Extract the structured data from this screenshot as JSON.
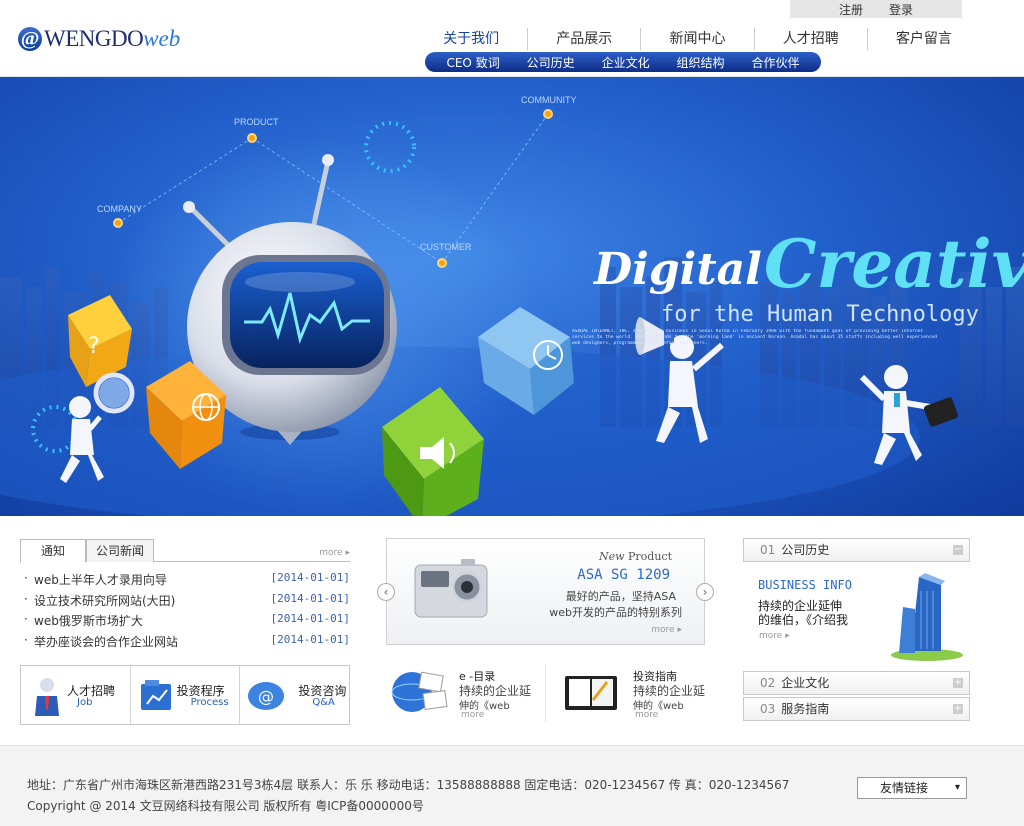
{
  "topbar": {
    "register": "注册",
    "login": "登录"
  },
  "logo": {
    "at": "@",
    "name_a": "WENGDO",
    "name_b": "web"
  },
  "nav": {
    "items": [
      "关于我们",
      "产品展示",
      "新闻中心",
      "人才招聘",
      "客户留言"
    ],
    "active": 0,
    "sub_items": [
      "CEO 致词",
      "公司历史",
      "企业文化",
      "组织结构",
      "合作伙伴"
    ]
  },
  "banner": {
    "word1": "Digital",
    "word2": "Creative",
    "tagline": "for the Human Technology",
    "blurb": "ASADAL INTERNET, INC. started its business in Seoul Korea in February 1998 with the fundament goal of providing better internet services to the world. ASADAL stands for the 'morning land' in ancient Korean. Asadal has about 35 staffs including well experienced web designers, programmers, and server engineers.",
    "labels": {
      "product": "PRODUCT",
      "community": "COMMUNITY",
      "company": "COMPANY",
      "customer": "CUSTOMER"
    }
  },
  "news": {
    "tabs": [
      "通知",
      "公司新闻"
    ],
    "more": "more",
    "bullet": "·",
    "items": [
      {
        "title": "web上半年人才录用向导",
        "date": "[2014-01-01]"
      },
      {
        "title": "设立技术研究所网站(大田)",
        "date": "[2014-01-01]"
      },
      {
        "title": "web俄罗斯市场扩大",
        "date": "[2014-01-01]"
      },
      {
        "title": "举办座谈会的合作企业网站",
        "date": "[2014-01-01]"
      }
    ]
  },
  "quick": [
    {
      "title": "人才招聘",
      "sub": "Job"
    },
    {
      "title": "投资程序",
      "sub": "Process"
    },
    {
      "title": "投资咨询",
      "sub": "Q&A"
    }
  ],
  "product": {
    "new_label_a": "New",
    "new_label_b": "Product",
    "model": "ASA SG 1209",
    "desc1": "最好的产品，坚持ASA",
    "desc2": "web开发的产品的特别系列",
    "more": "more"
  },
  "features": [
    {
      "title": "e -目录",
      "line1": "持续的企业延",
      "line2": "伸的《web",
      "more": "more"
    },
    {
      "title": "投资指南",
      "line1": "持续的企业延",
      "line2": "伸的《web",
      "more": "more"
    }
  ],
  "right": {
    "box1": {
      "num": "01",
      "title": "公司历史",
      "pm": "−"
    },
    "business_info": "BUSINESS INFO",
    "info1": "持续的企业延伸",
    "info2": "的维伯，《介绍我",
    "more": "more",
    "box2": {
      "num": "02",
      "title": "企业文化",
      "pm": "+"
    },
    "box3": {
      "num": "03",
      "title": "服务指南",
      "pm": "+"
    }
  },
  "footer": {
    "line1": "地址：广东省广州市海珠区新港西路231号3栋4层  联系人：乐 乐  移动电话：13588888888 固定电话：020-1234567 传 真：020-1234567",
    "line2": "Copyright @ 2014 文豆网络科技有限公司 版权所有  粤ICP备0000000号",
    "friend_links": "友情链接"
  },
  "colors": {
    "accent": "#1443a6",
    "banner": "#2260cb",
    "date": "#3b62b0"
  }
}
